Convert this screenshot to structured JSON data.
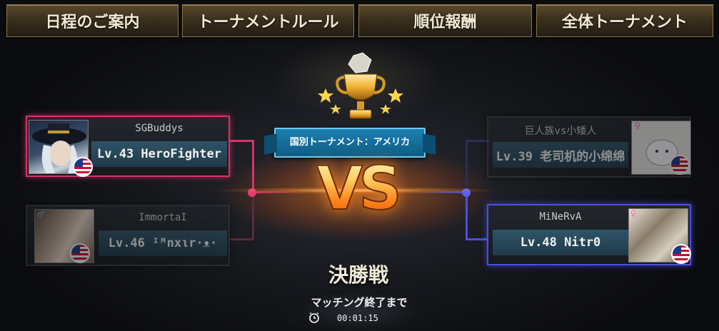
{
  "tabs": [
    {
      "label": "日程のご案内"
    },
    {
      "label": "トーナメントルール"
    },
    {
      "label": "順位報酬"
    },
    {
      "label": "全体トーナメント"
    }
  ],
  "bracket": {
    "banner": "国別トーナメント：アメリカ",
    "vs": "VS",
    "left": [
      {
        "name": "SGBuddys",
        "level": "Lv.43 HeroFighter",
        "flag": "us-flag-icon",
        "winner": true
      },
      {
        "name": "ImmortaI",
        "level": "Lv.46 ᴵᴹnxιr·ᴥ·",
        "flag": "us-flag-icon",
        "winner": false
      }
    ],
    "right": [
      {
        "name": "巨人族vs小矮人",
        "level": "Lv.39 老司机的小绵绵",
        "flag": "us-flag-icon",
        "winner": false
      },
      {
        "name": "MiNeRvA",
        "level": "Lv.48 Nitr0",
        "flag": "us-flag-icon",
        "winner": true
      }
    ]
  },
  "finals": {
    "title": "決勝戦",
    "countdown_label": "マッチング終了まで",
    "countdown_time": "00:01:15"
  },
  "colors": {
    "winner_left": "#d6336b",
    "winner_right": "#4b4fe0",
    "accent": "#ff8a1d"
  }
}
